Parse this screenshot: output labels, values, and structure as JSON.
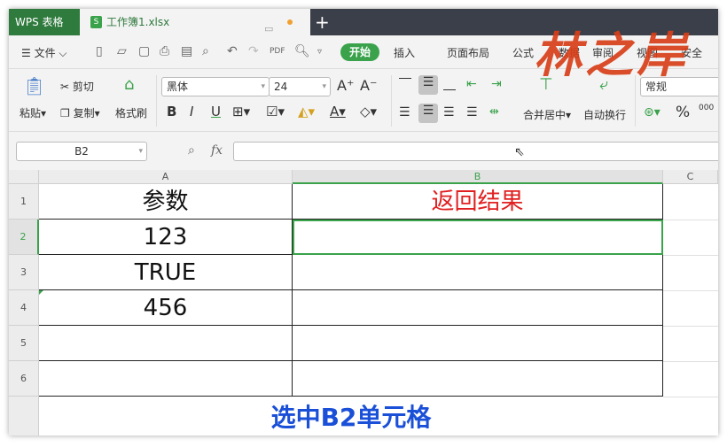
{
  "titlebar": {
    "app": "WPS 表格",
    "doc": "工作簿1.xlsx",
    "doc_icon": "S",
    "new_tab": "+"
  },
  "toolbar": {
    "file": "文件",
    "tabs": [
      "开始",
      "插入",
      "页面布局",
      "公式",
      "数据",
      "审阅",
      "视图",
      "安全"
    ]
  },
  "ribbon": {
    "paste": "粘贴",
    "cut": "剪切",
    "copy": "复制",
    "format_painter": "格式刷",
    "font": "黑体",
    "size": "24",
    "bold": "B",
    "italic": "I",
    "underline": "U",
    "merge": "合并居中",
    "wrap": "自动换行",
    "number_format": "常规",
    "percent": "%"
  },
  "formula_bar": {
    "name_box": "B2",
    "fx": "fx",
    "value": ""
  },
  "sheet": {
    "columns": [
      "A",
      "B",
      "C"
    ],
    "rows": [
      "1",
      "2",
      "3",
      "4",
      "5",
      "6"
    ],
    "cells": {
      "A1": "参数",
      "B1": "返回结果",
      "A2": "123",
      "A3": "TRUE",
      "A4": "456"
    },
    "caption": "选中B2单元格"
  },
  "watermark": "林之岸",
  "colors": {
    "accent": "#3aa24b",
    "header_red": "#e02020",
    "caption_blue": "#1a4fd8"
  }
}
